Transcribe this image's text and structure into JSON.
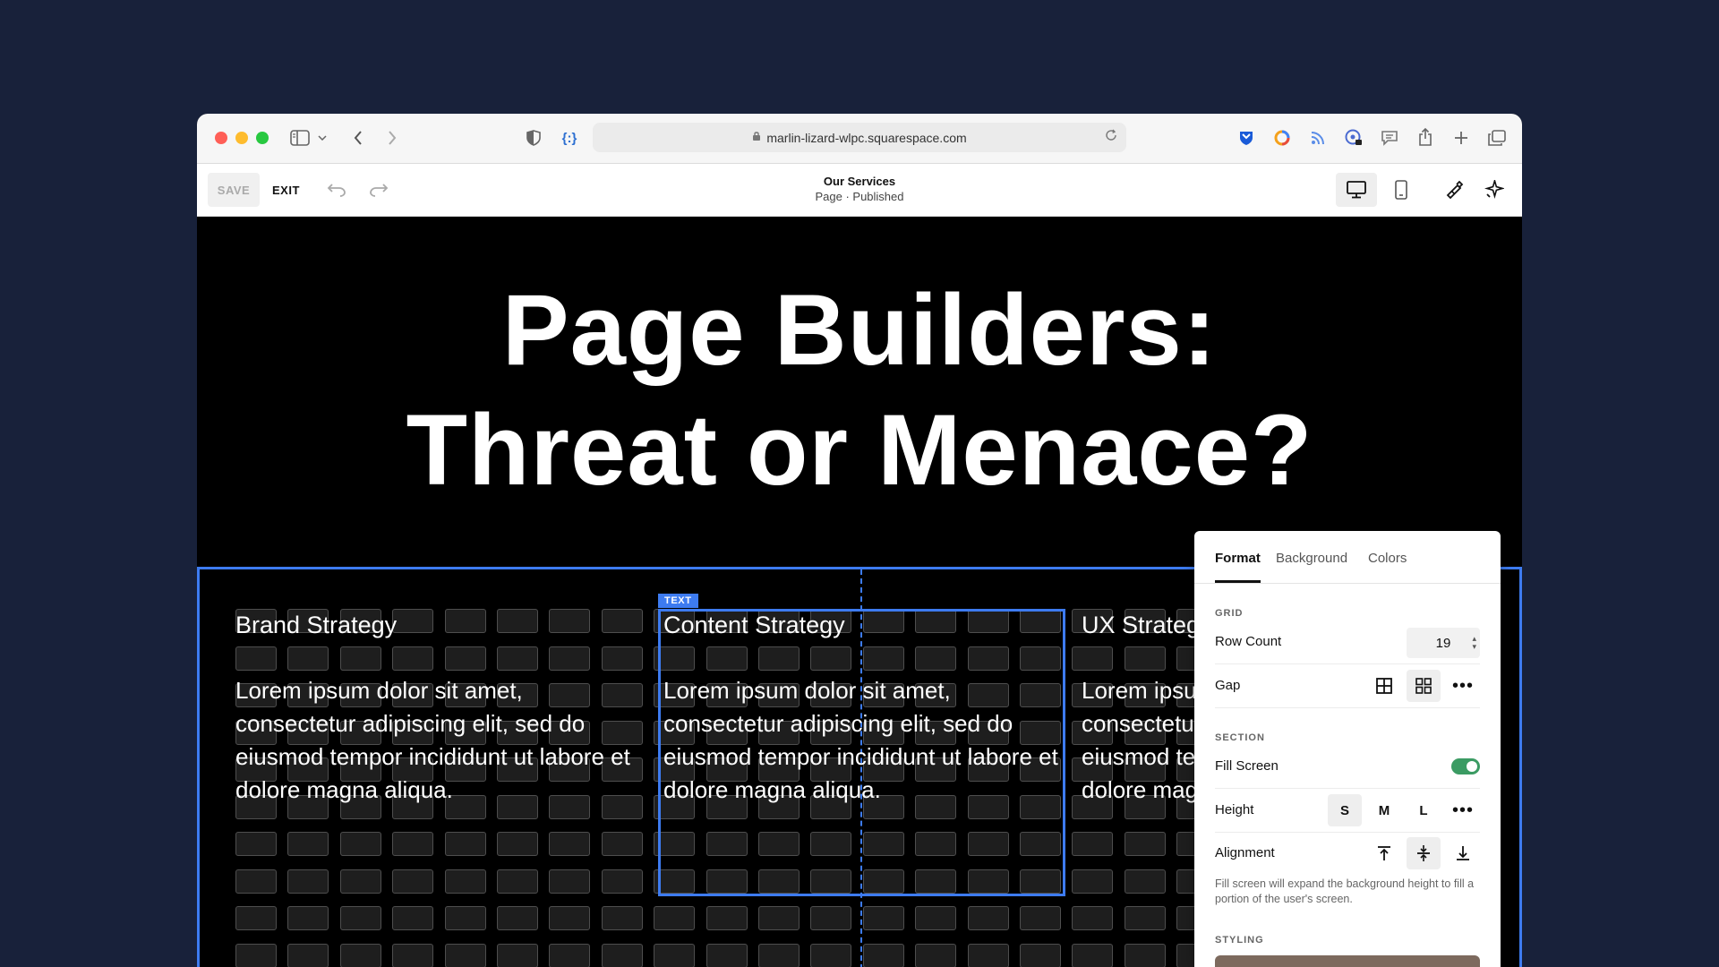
{
  "browser": {
    "url": "marlin-lizard-wlpc.squarespace.com",
    "colors": {
      "close": "#ff5f57",
      "minimize": "#febc2e",
      "zoom": "#28c840"
    },
    "icons": [
      "sidebar-icon",
      "chevron-down-icon",
      "back-icon",
      "forward-icon",
      "shield-icon",
      "code-braces-icon",
      "lock-icon",
      "reload-icon",
      "bitwarden-icon",
      "color-wheel-icon",
      "rss-icon",
      "password-icon",
      "chat-icon",
      "share-icon",
      "plus-icon",
      "tabs-icon"
    ]
  },
  "toolbar": {
    "save_label": "SAVE",
    "exit_label": "EXIT",
    "page_name": "Our Services",
    "page_status": "Page · Published"
  },
  "hero": {
    "title_line1": "Page Builders:",
    "title_line2": "Threat or Menace?"
  },
  "section": {
    "selected_tag": "TEXT",
    "columns": [
      {
        "heading": "Brand Strategy",
        "body": "Lorem ipsum dolor sit amet, consectetur adipiscing elit, sed do eiusmod tempor incididunt ut labore et dolore magna aliqua."
      },
      {
        "heading": "Content Strategy",
        "body": "Lorem ipsum dolor sit amet, consectetur adipiscing elit, sed do eiusmod tempor incididunt ut labore et dolore magna aliqua."
      },
      {
        "heading": "UX Strategy",
        "body": "Lorem ipsum dolor sit amet, consectetur adipiscing elit, sed do eiusmod tempor incididunt ut labore et dolore magna aliqua."
      }
    ]
  },
  "panel": {
    "tabs": [
      "Format",
      "Background",
      "Colors"
    ],
    "active_tab": "Format",
    "grid_label": "GRID",
    "row_count_label": "Row Count",
    "row_count": "19",
    "gap_label": "Gap",
    "section_label": "SECTION",
    "fill_screen_label": "Fill Screen",
    "fill_screen_on": true,
    "height_label": "Height",
    "height_options": [
      "S",
      "M",
      "L"
    ],
    "height_selected": "S",
    "alignment_label": "Alignment",
    "alignment_selected": "middle",
    "help_text": "Fill screen will expand the background height to fill a portion of the user's screen.",
    "styling_label": "STYLING",
    "accent": "#3b9b63"
  },
  "accent_color": "#3d7bf0"
}
